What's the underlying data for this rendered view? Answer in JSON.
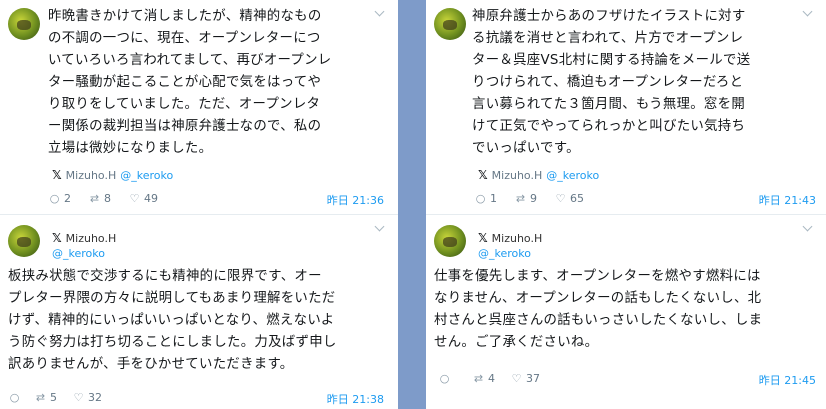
{
  "tweets": {
    "t1": {
      "lines": [
        "昨晩書きかけて消しましたが、精神的なもの",
        "の不調の一つに、現在、オープンレターにつ",
        "いていろいろ言われてまして、再びオープンレ",
        "ター騒動が起こることが心配で気をはってや",
        "り取りをしていました。ただ、オープンレタ",
        "ー関係の裁判担当は神原弁護士なので、私の",
        "立場は微妙になりました。"
      ],
      "source_name": "Mizuho.H",
      "source_handle": "@_keroko",
      "replies": "2",
      "retweets": "8",
      "likes": "49",
      "time": "昨日 21:36"
    },
    "t2": {
      "name": "Mizuho.H",
      "handle": "@_keroko",
      "lines": [
        "板挟み状態で交渉するにも精神的に限界です、オー",
        "プレター界隈の方々に説明してもあまり理解をいただ",
        "けず、精神的にいっぱいいっぱいとなり、燃えないよ",
        "う防ぐ努力は打ち切ることにしました。力及ばず申し",
        "訳ありませんが、手をひかせていただきます。"
      ],
      "replies": "",
      "retweets": "5",
      "likes": "32",
      "time": "昨日 21:38"
    },
    "t3": {
      "lines": [
        "神原弁護士からあのフザけたイラストに対す",
        "る抗議を消せと言われて、片方でオープンレ",
        "ター＆呉座VS北村に関する持論をメールで送",
        "りつけられて、橋迫もオープンレターだろと",
        "言い募られてた３箇月間、もう無理。窓を開",
        "けて正気でやってられっかと叫びたい気持ち",
        "でいっぱいです。"
      ],
      "source_name": "Mizuho.H",
      "source_handle": "@_keroko",
      "replies": "1",
      "retweets": "9",
      "likes": "65",
      "time": "昨日 21:43"
    },
    "t4": {
      "name": "Mizuho.H",
      "handle": "@_keroko",
      "lines": [
        "仕事を優先します、オープンレターを燃やす燃料には",
        "なりません、オープンレターの話もしたくないし、北",
        "村さんと呉座さんの話もいっさいしたくないし、しま",
        "せん。ご了承くださいね。"
      ],
      "replies": "",
      "retweets": "4",
      "likes": "37",
      "time": "昨日 21:45"
    }
  },
  "icons": {
    "x_logo": "𝕏",
    "reply": "○",
    "retweet": "⇄",
    "like": "♡"
  },
  "colors": {
    "divider": "#7e9bc9",
    "link": "#1d9bf0",
    "muted": "#657786"
  }
}
